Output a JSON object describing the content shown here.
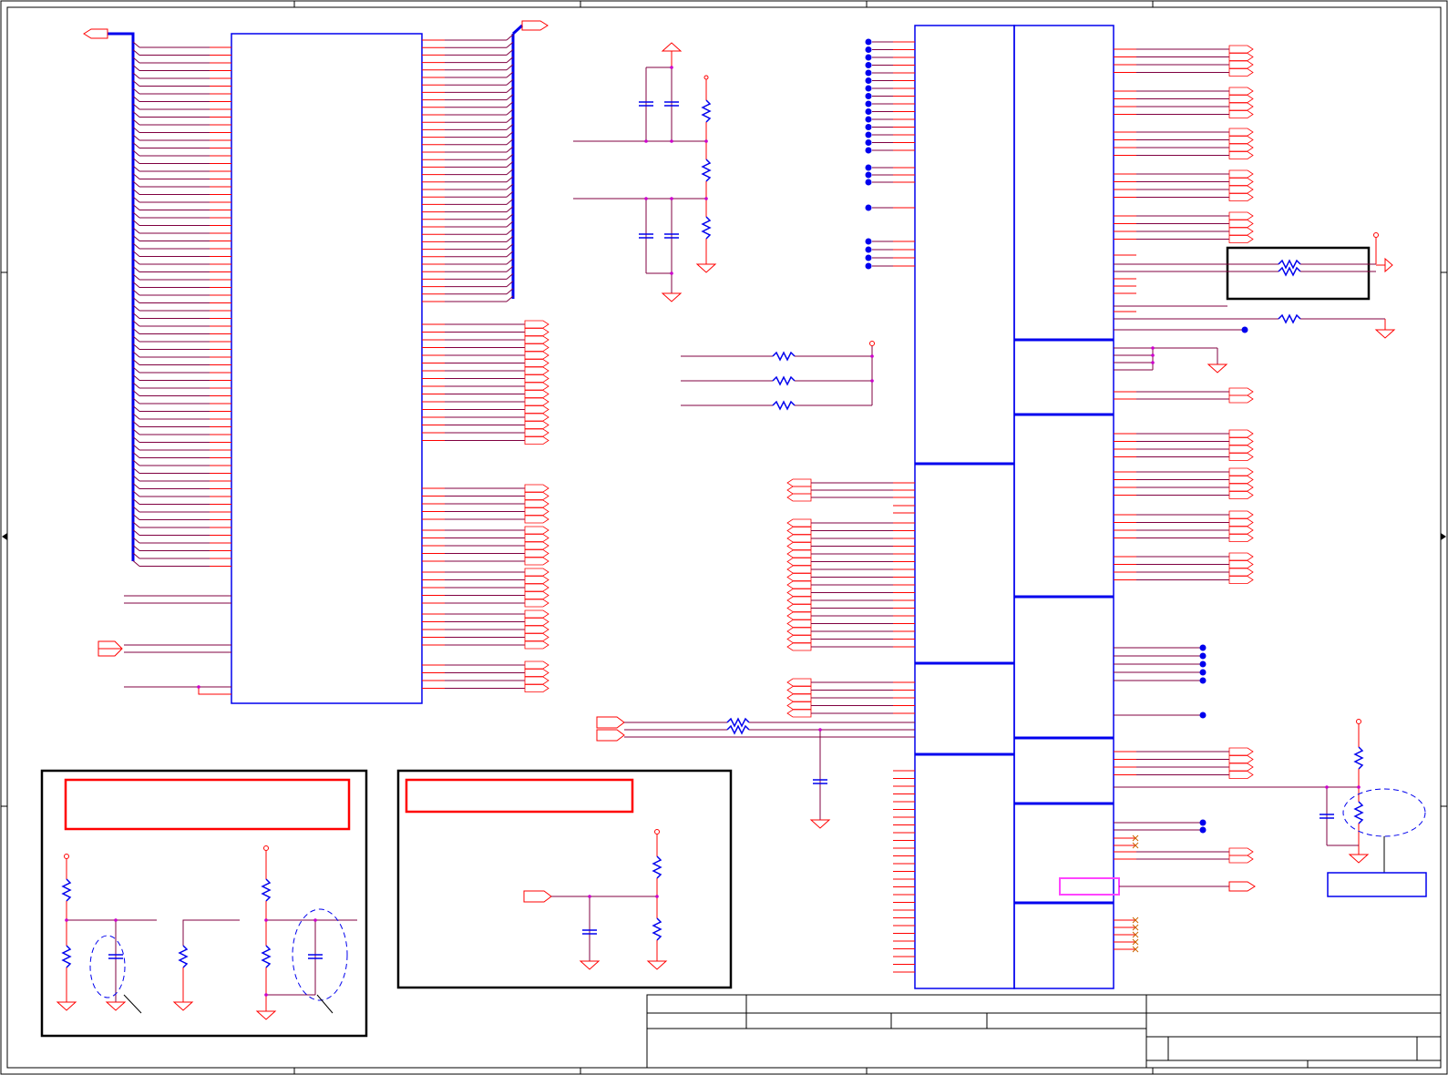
{
  "sheet": {
    "description": "",
    "line_colors": {
      "bus": "#0000ee",
      "pin": "#ff0000",
      "wire": "#800040",
      "frame": "#000000",
      "note_box": "#ff0000",
      "highlight_box": "#ff44ff",
      "junction": "#cc00cc"
    }
  }
}
